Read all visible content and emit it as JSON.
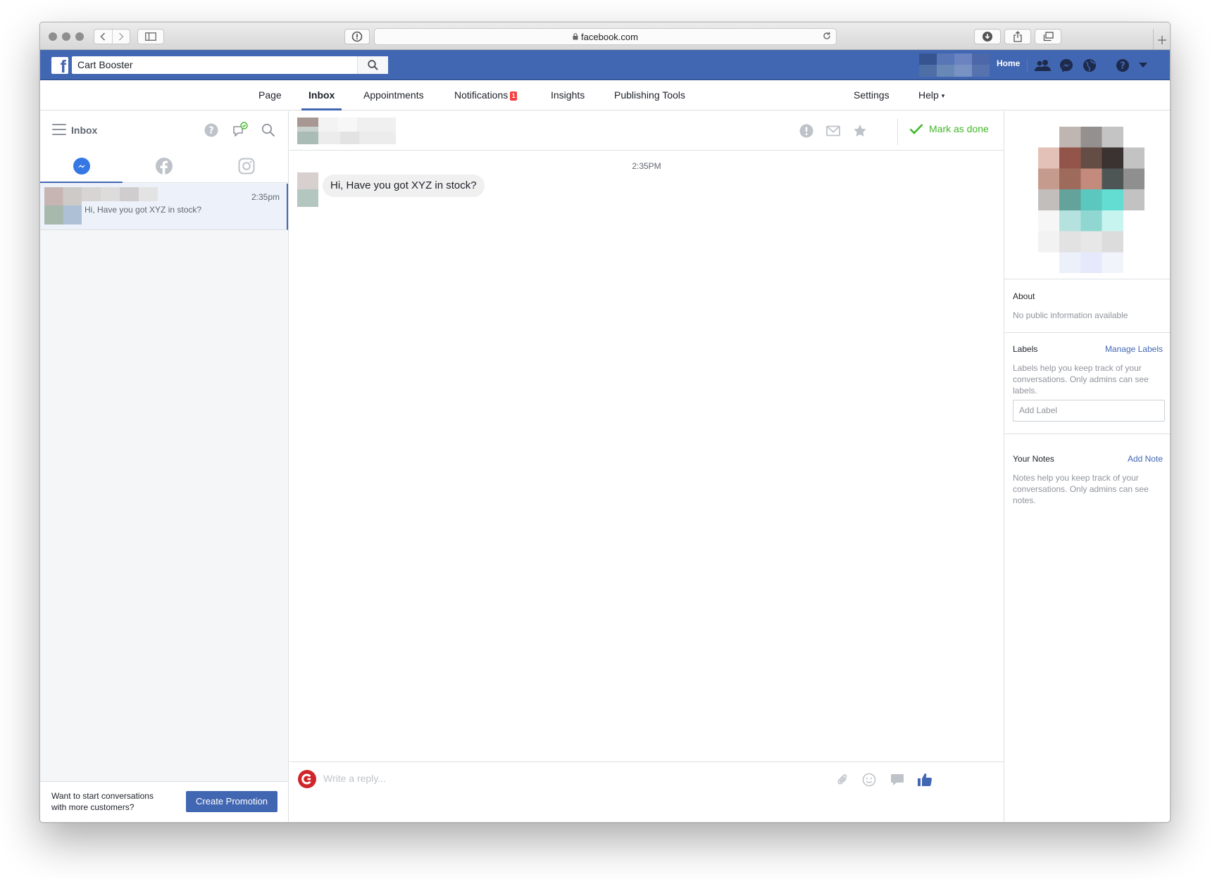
{
  "browser": {
    "url": "facebook.com"
  },
  "topbar": {
    "search_value": "Cart Booster",
    "home_label": "Home"
  },
  "page_tabs": {
    "page": "Page",
    "inbox": "Inbox",
    "appointments": "Appointments",
    "notifications": "Notifications",
    "notifications_badge": "1",
    "insights": "Insights",
    "publishing_tools": "Publishing Tools",
    "settings": "Settings",
    "help": "Help",
    "help_caret": "▾"
  },
  "inbox": {
    "title": "Inbox",
    "channels": [
      "messenger-icon",
      "facebook-icon",
      "instagram-icon"
    ],
    "conversations": [
      {
        "time": "2:35pm",
        "preview": "Hi, Have you got XYZ in stock?"
      }
    ],
    "promo_text": "Want to start conversations with more customers?",
    "promo_button": "Create Promotion"
  },
  "conversation": {
    "mark_done_label": "Mark as done",
    "messages": [
      {
        "time": "2:35PM",
        "text": "Hi, Have you got XYZ in stock?"
      }
    ],
    "reply_placeholder": "Write a reply..."
  },
  "details": {
    "about_title": "About",
    "about_text": "No public information available",
    "labels_title": "Labels",
    "labels_link": "Manage Labels",
    "labels_text": "Labels help you keep track of your conversations. Only admins can see labels.",
    "add_label_placeholder": "Add Label",
    "notes_title": "Your Notes",
    "notes_link": "Add Note",
    "notes_text": "Notes help you keep track of your conversations. Only admins can see notes."
  },
  "colors": {
    "facebook_blue": "#4267b2",
    "done_green": "#42b72a",
    "badge_red": "#fa3e3e",
    "messenger_blue": "#3578e5"
  }
}
